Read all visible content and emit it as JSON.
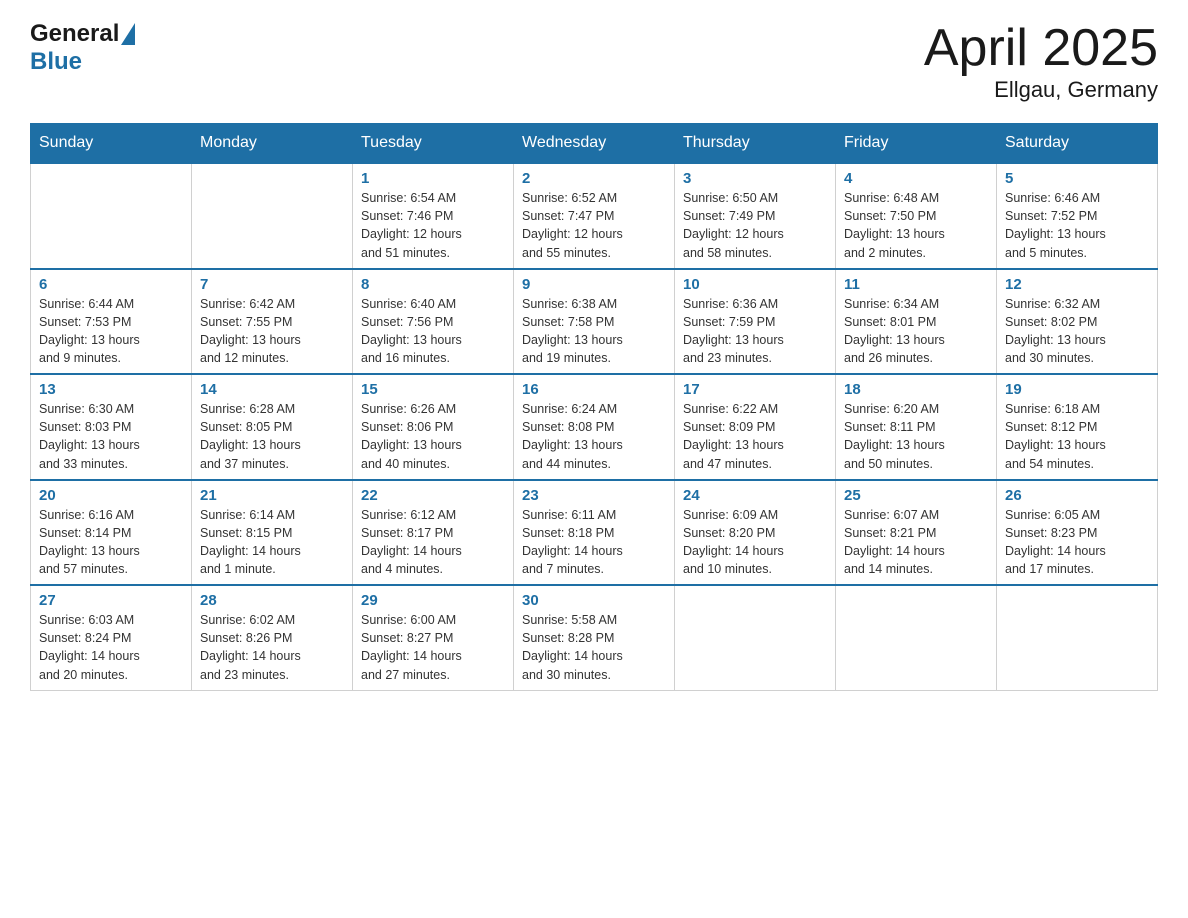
{
  "header": {
    "logo_general": "General",
    "logo_blue": "Blue",
    "month_title": "April 2025",
    "location": "Ellgau, Germany"
  },
  "weekdays": [
    "Sunday",
    "Monday",
    "Tuesday",
    "Wednesday",
    "Thursday",
    "Friday",
    "Saturday"
  ],
  "weeks": [
    [
      {
        "day": "",
        "info": ""
      },
      {
        "day": "",
        "info": ""
      },
      {
        "day": "1",
        "info": "Sunrise: 6:54 AM\nSunset: 7:46 PM\nDaylight: 12 hours\nand 51 minutes."
      },
      {
        "day": "2",
        "info": "Sunrise: 6:52 AM\nSunset: 7:47 PM\nDaylight: 12 hours\nand 55 minutes."
      },
      {
        "day": "3",
        "info": "Sunrise: 6:50 AM\nSunset: 7:49 PM\nDaylight: 12 hours\nand 58 minutes."
      },
      {
        "day": "4",
        "info": "Sunrise: 6:48 AM\nSunset: 7:50 PM\nDaylight: 13 hours\nand 2 minutes."
      },
      {
        "day": "5",
        "info": "Sunrise: 6:46 AM\nSunset: 7:52 PM\nDaylight: 13 hours\nand 5 minutes."
      }
    ],
    [
      {
        "day": "6",
        "info": "Sunrise: 6:44 AM\nSunset: 7:53 PM\nDaylight: 13 hours\nand 9 minutes."
      },
      {
        "day": "7",
        "info": "Sunrise: 6:42 AM\nSunset: 7:55 PM\nDaylight: 13 hours\nand 12 minutes."
      },
      {
        "day": "8",
        "info": "Sunrise: 6:40 AM\nSunset: 7:56 PM\nDaylight: 13 hours\nand 16 minutes."
      },
      {
        "day": "9",
        "info": "Sunrise: 6:38 AM\nSunset: 7:58 PM\nDaylight: 13 hours\nand 19 minutes."
      },
      {
        "day": "10",
        "info": "Sunrise: 6:36 AM\nSunset: 7:59 PM\nDaylight: 13 hours\nand 23 minutes."
      },
      {
        "day": "11",
        "info": "Sunrise: 6:34 AM\nSunset: 8:01 PM\nDaylight: 13 hours\nand 26 minutes."
      },
      {
        "day": "12",
        "info": "Sunrise: 6:32 AM\nSunset: 8:02 PM\nDaylight: 13 hours\nand 30 minutes."
      }
    ],
    [
      {
        "day": "13",
        "info": "Sunrise: 6:30 AM\nSunset: 8:03 PM\nDaylight: 13 hours\nand 33 minutes."
      },
      {
        "day": "14",
        "info": "Sunrise: 6:28 AM\nSunset: 8:05 PM\nDaylight: 13 hours\nand 37 minutes."
      },
      {
        "day": "15",
        "info": "Sunrise: 6:26 AM\nSunset: 8:06 PM\nDaylight: 13 hours\nand 40 minutes."
      },
      {
        "day": "16",
        "info": "Sunrise: 6:24 AM\nSunset: 8:08 PM\nDaylight: 13 hours\nand 44 minutes."
      },
      {
        "day": "17",
        "info": "Sunrise: 6:22 AM\nSunset: 8:09 PM\nDaylight: 13 hours\nand 47 minutes."
      },
      {
        "day": "18",
        "info": "Sunrise: 6:20 AM\nSunset: 8:11 PM\nDaylight: 13 hours\nand 50 minutes."
      },
      {
        "day": "19",
        "info": "Sunrise: 6:18 AM\nSunset: 8:12 PM\nDaylight: 13 hours\nand 54 minutes."
      }
    ],
    [
      {
        "day": "20",
        "info": "Sunrise: 6:16 AM\nSunset: 8:14 PM\nDaylight: 13 hours\nand 57 minutes."
      },
      {
        "day": "21",
        "info": "Sunrise: 6:14 AM\nSunset: 8:15 PM\nDaylight: 14 hours\nand 1 minute."
      },
      {
        "day": "22",
        "info": "Sunrise: 6:12 AM\nSunset: 8:17 PM\nDaylight: 14 hours\nand 4 minutes."
      },
      {
        "day": "23",
        "info": "Sunrise: 6:11 AM\nSunset: 8:18 PM\nDaylight: 14 hours\nand 7 minutes."
      },
      {
        "day": "24",
        "info": "Sunrise: 6:09 AM\nSunset: 8:20 PM\nDaylight: 14 hours\nand 10 minutes."
      },
      {
        "day": "25",
        "info": "Sunrise: 6:07 AM\nSunset: 8:21 PM\nDaylight: 14 hours\nand 14 minutes."
      },
      {
        "day": "26",
        "info": "Sunrise: 6:05 AM\nSunset: 8:23 PM\nDaylight: 14 hours\nand 17 minutes."
      }
    ],
    [
      {
        "day": "27",
        "info": "Sunrise: 6:03 AM\nSunset: 8:24 PM\nDaylight: 14 hours\nand 20 minutes."
      },
      {
        "day": "28",
        "info": "Sunrise: 6:02 AM\nSunset: 8:26 PM\nDaylight: 14 hours\nand 23 minutes."
      },
      {
        "day": "29",
        "info": "Sunrise: 6:00 AM\nSunset: 8:27 PM\nDaylight: 14 hours\nand 27 minutes."
      },
      {
        "day": "30",
        "info": "Sunrise: 5:58 AM\nSunset: 8:28 PM\nDaylight: 14 hours\nand 30 minutes."
      },
      {
        "day": "",
        "info": ""
      },
      {
        "day": "",
        "info": ""
      },
      {
        "day": "",
        "info": ""
      }
    ]
  ]
}
